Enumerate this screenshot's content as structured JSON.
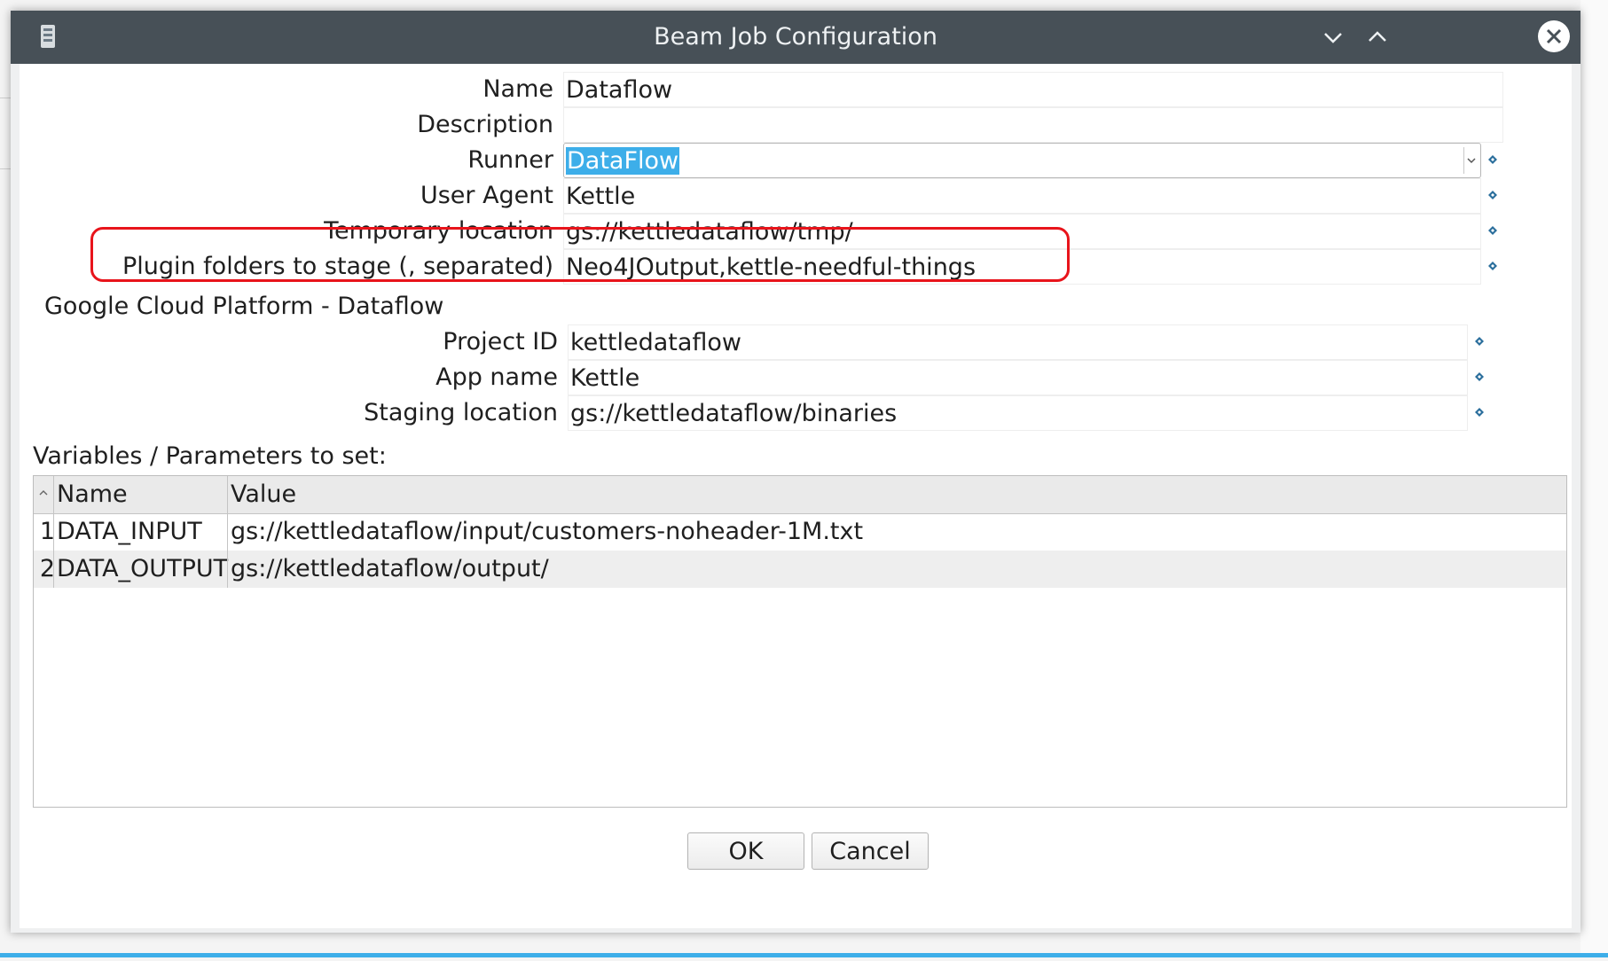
{
  "window": {
    "title": "Beam Job Configuration"
  },
  "form": {
    "name": {
      "label": "Name",
      "value": "Dataflow"
    },
    "description": {
      "label": "Description",
      "value": ""
    },
    "runner": {
      "label": "Runner",
      "value": "DataFlow"
    },
    "user_agent": {
      "label": "User Agent",
      "value": "Kettle"
    },
    "temp_location": {
      "label": "Temporary location",
      "value": "gs://kettledataflow/tmp/"
    },
    "plugin_folders": {
      "label": "Plugin folders to stage (, separated)",
      "value": "Neo4JOutput,kettle-needful-things"
    }
  },
  "gcp": {
    "section_title": "Google Cloud Platform - Dataflow",
    "project_id": {
      "label": "Project ID",
      "value": "kettledataflow"
    },
    "app_name": {
      "label": "App name",
      "value": "Kettle"
    },
    "staging_location": {
      "label": "Staging location",
      "value": "gs://kettledataflow/binaries"
    }
  },
  "params": {
    "label": "Variables / Parameters to set:",
    "columns": [
      "Name",
      "Value"
    ],
    "rows": [
      {
        "num": "1",
        "name": "DATA_INPUT",
        "value": "gs://kettledataflow/input/customers-noheader-1M.txt"
      },
      {
        "num": "2",
        "name": "DATA_OUTPUT",
        "value": "gs://kettledataflow/output/"
      }
    ]
  },
  "buttons": {
    "ok": "OK",
    "cancel": "Cancel"
  },
  "colors": {
    "titlebar": "#475057",
    "selection": "#3daee9",
    "highlight": "#e8141b"
  }
}
